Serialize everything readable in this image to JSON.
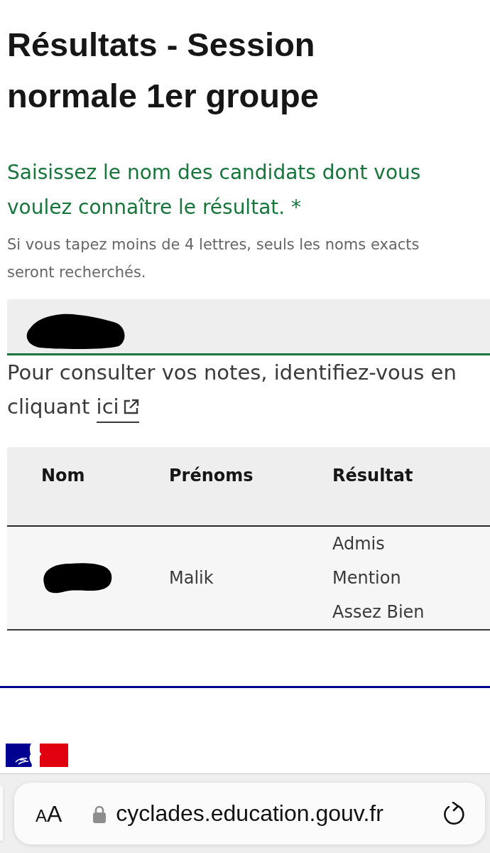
{
  "page": {
    "title": "Résultats - Session normale 1er groupe"
  },
  "search": {
    "label": "Saisissez le nom des candidats dont vous voulez connaître le résultat. *",
    "hint": "Si vous tapez moins de 4 lettres, seuls les noms exacts seront recherchés.",
    "value_redacted": true
  },
  "notice": {
    "text": "Pour consulter vos notes, identifiez-vous en cliquant",
    "link": "ici"
  },
  "table": {
    "columns": [
      "Nom",
      "Prénoms",
      "Résultat"
    ],
    "rows": [
      {
        "cells": [
          {
            "redacted": true
          },
          {
            "lines": [
              "Malik"
            ]
          },
          {
            "lines": [
              "Admis",
              "Mention",
              "Assez Bien"
            ]
          }
        ]
      }
    ]
  },
  "browser": {
    "reader_button": "AA",
    "url": "cyclades.education.gouv.fr",
    "secure": true
  }
}
